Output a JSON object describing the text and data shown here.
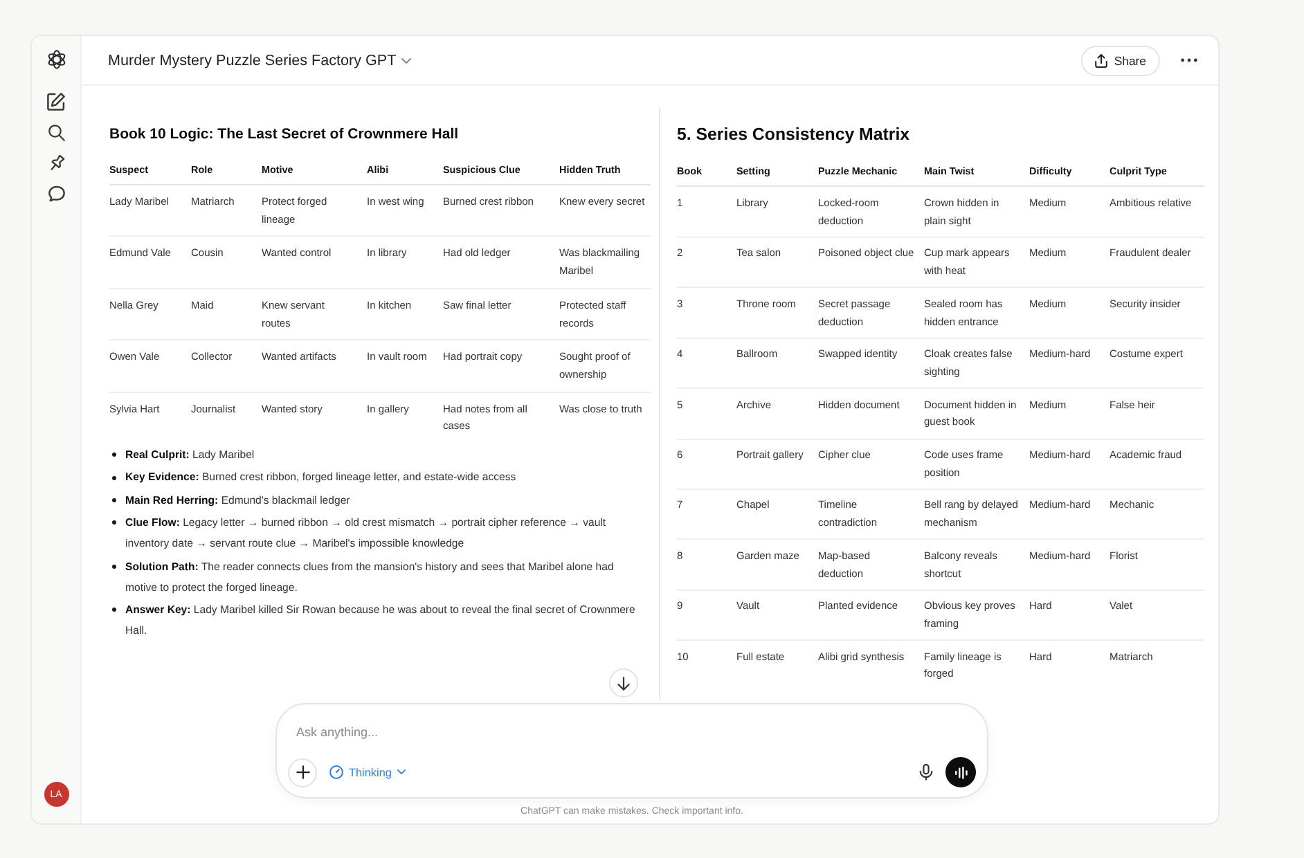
{
  "sidebar": {
    "avatar": "LA"
  },
  "header": {
    "title": "Murder Mystery Puzzle Series Factory GPT",
    "share": "Share"
  },
  "left_panel": {
    "heading": "Book 10 Logic: The Last Secret of Crownmere Hall",
    "table": {
      "columns": [
        "Suspect",
        "Role",
        "Motive",
        "Alibi",
        "Suspicious Clue",
        "Hidden Truth"
      ],
      "rows": [
        [
          "Lady Maribel",
          "Matriarch",
          "Protect forged lineage",
          "In west wing",
          "Burned crest ribbon",
          "Knew every secret"
        ],
        [
          "Edmund Vale",
          "Cousin",
          "Wanted control",
          "In library",
          "Had old ledger",
          "Was blackmailing Maribel"
        ],
        [
          "Nella Grey",
          "Maid",
          "Knew servant routes",
          "In kitchen",
          "Saw final letter",
          "Protected staff records"
        ],
        [
          "Owen Vale",
          "Collector",
          "Wanted artifacts",
          "In vault room",
          "Had portrait copy",
          "Sought proof of ownership"
        ],
        [
          "Sylvia Hart",
          "Journalist",
          "Wanted story",
          "In gallery",
          "Had notes from all cases",
          "Was close to truth"
        ]
      ]
    },
    "bullets": [
      "**Real Culprit:** Lady Maribel",
      "**Key Evidence:** Burned crest ribbon, forged lineage letter, and estate-wide access",
      "**Main Red Herring:** Edmund's blackmail ledger",
      "**Clue Flow:** Legacy letter → burned ribbon → old crest mismatch → portrait cipher reference → vault inventory date → servant route clue → Maribel's impossible knowledge",
      "**Solution Path:** The reader connects clues from the mansion's history and sees that Maribel alone had motive to protect the forged lineage.",
      "**Answer Key:** Lady Maribel killed Sir Rowan because he was about to reveal the final secret of Crownmere Hall."
    ]
  },
  "right_panel": {
    "heading": "5. Series Consistency Matrix",
    "table": {
      "columns": [
        "Book",
        "Setting",
        "Puzzle Mechanic",
        "Main Twist",
        "Difficulty",
        "Culprit Type"
      ],
      "rows": [
        [
          "1",
          "Library",
          "Locked-room deduction",
          "Crown hidden in plain sight",
          "Medium",
          "Ambitious relative"
        ],
        [
          "2",
          "Tea salon",
          "Poisoned object clue",
          "Cup mark appears with heat",
          "Medium",
          "Fraudulent dealer"
        ],
        [
          "3",
          "Throne room",
          "Secret passage deduction",
          "Sealed room has hidden entrance",
          "Medium",
          "Security insider"
        ],
        [
          "4",
          "Ballroom",
          "Swapped identity",
          "Cloak creates false sighting",
          "Medium-hard",
          "Costume expert"
        ],
        [
          "5",
          "Archive",
          "Hidden document",
          "Document hidden in guest book",
          "Medium",
          "False heir"
        ],
        [
          "6",
          "Portrait gallery",
          "Cipher clue",
          "Code uses frame position",
          "Medium-hard",
          "Academic fraud"
        ],
        [
          "7",
          "Chapel",
          "Timeline contradiction",
          "Bell rang by delayed mechanism",
          "Medium-hard",
          "Mechanic"
        ],
        [
          "8",
          "Garden maze",
          "Map-based deduction",
          "Balcony reveals shortcut",
          "Medium-hard",
          "Florist"
        ],
        [
          "9",
          "Vault",
          "Planted evidence",
          "Obvious key proves framing",
          "Hard",
          "Valet"
        ],
        [
          "10",
          "Full estate",
          "Alibi grid synthesis",
          "Family lineage is forged",
          "Hard",
          "Matriarch"
        ]
      ]
    }
  },
  "composer": {
    "placeholder": "Ask anything...",
    "mode": "Thinking"
  },
  "footer_note": "ChatGPT can make mistakes. Check important info."
}
